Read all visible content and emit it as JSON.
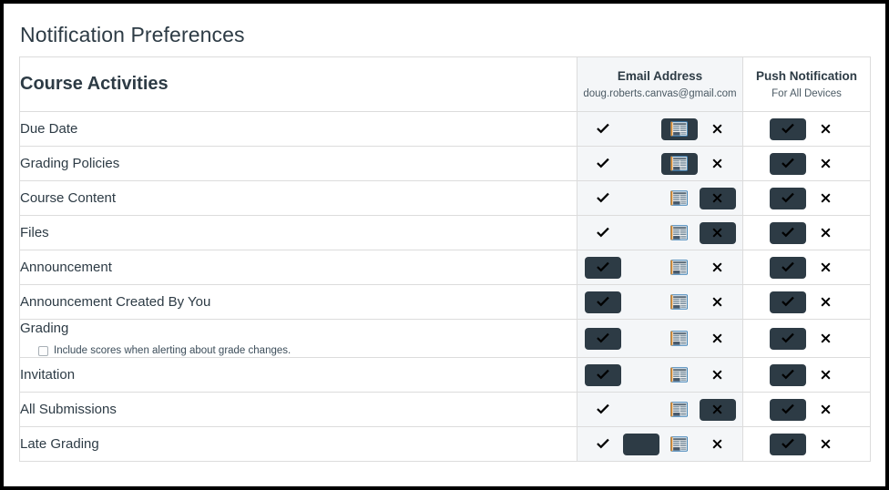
{
  "page": {
    "title": "Notification Preferences"
  },
  "table": {
    "name_column_header": "Course Activities",
    "channels": [
      {
        "key": "email",
        "title": "Email Address",
        "subtitle": "doug.roberts.canvas@gmail.com",
        "options": [
          "asap-check-icon",
          "daily-clock-icon",
          "weekly-newspaper-icon",
          "never-x-icon"
        ],
        "option_labels": [
          "Notify me right away",
          "Daily summary",
          "Weekly summary",
          "Notifications off"
        ]
      },
      {
        "key": "push",
        "title": "Push Notification",
        "subtitle": "For All Devices",
        "options": [
          "asap-check-icon",
          "never-x-icon"
        ],
        "option_labels": [
          "Notify me right away",
          "Notifications off"
        ]
      }
    ],
    "rows": [
      {
        "label": "Due Date",
        "sub_label": null,
        "sub_checkbox": false,
        "email_selected": 2,
        "push_selected": 0
      },
      {
        "label": "Grading Policies",
        "sub_label": null,
        "sub_checkbox": false,
        "email_selected": 2,
        "push_selected": 0
      },
      {
        "label": "Course Content",
        "sub_label": null,
        "sub_checkbox": false,
        "email_selected": 3,
        "push_selected": 0
      },
      {
        "label": "Files",
        "sub_label": null,
        "sub_checkbox": false,
        "email_selected": 3,
        "push_selected": 0
      },
      {
        "label": "Announcement",
        "sub_label": null,
        "sub_checkbox": false,
        "email_selected": 0,
        "push_selected": 0
      },
      {
        "label": "Announcement Created By You",
        "sub_label": null,
        "sub_checkbox": false,
        "email_selected": 0,
        "push_selected": 0
      },
      {
        "label": "Grading",
        "sub_label": "Include scores when alerting about grade changes.",
        "sub_checkbox": true,
        "sub_checkbox_checked": false,
        "email_selected": 0,
        "push_selected": 0
      },
      {
        "label": "Invitation",
        "sub_label": null,
        "sub_checkbox": false,
        "email_selected": 0,
        "push_selected": 0
      },
      {
        "label": "All Submissions",
        "sub_label": null,
        "sub_checkbox": false,
        "email_selected": 3,
        "push_selected": 0
      },
      {
        "label": "Late Grading",
        "sub_label": null,
        "sub_checkbox": false,
        "email_selected": 1,
        "push_selected": 0
      }
    ]
  },
  "colors": {
    "selected_background": "#2D3B45",
    "text": "#2D3B45",
    "email_column_background": "#f4f6f8",
    "table_border": "#dcdcdc",
    "page_background": "#ffffff"
  }
}
